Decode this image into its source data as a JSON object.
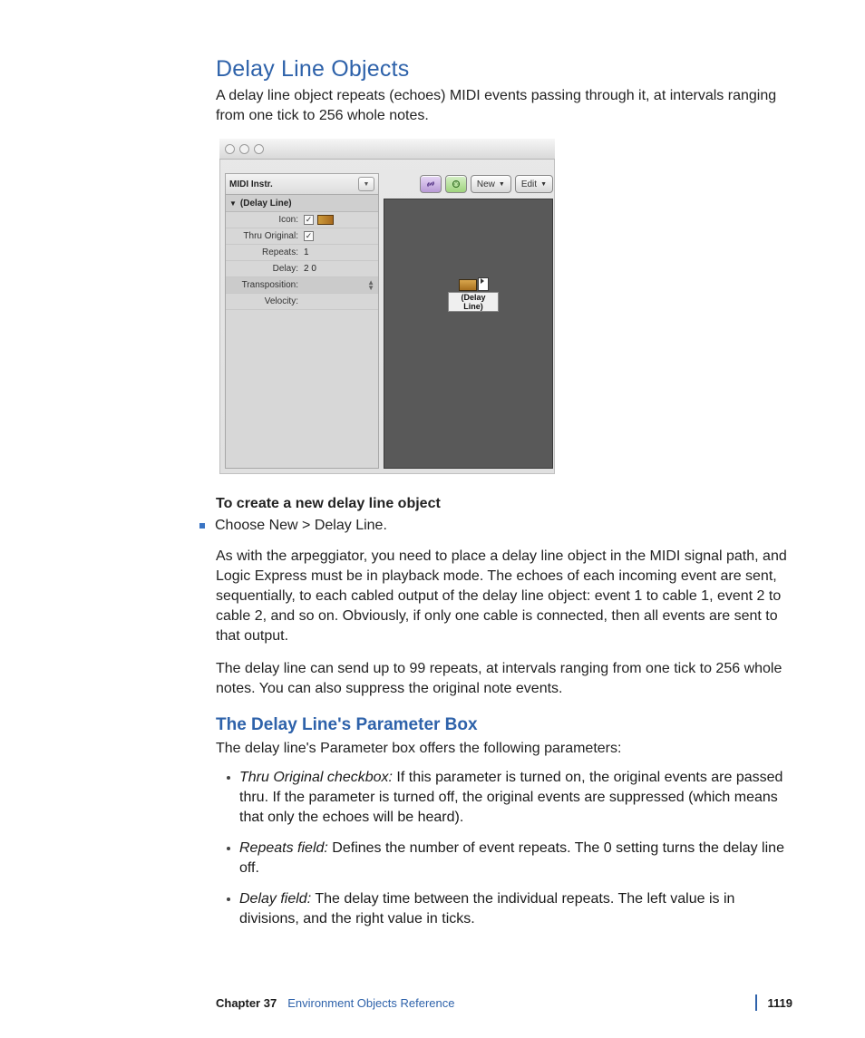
{
  "headings": {
    "h1": "Delay Line Objects",
    "h2": "The Delay Line's Parameter Box"
  },
  "paragraphs": {
    "intro": "A delay line object repeats (echoes) MIDI events passing through it, at intervals ranging from one tick to 256 whole notes.",
    "create_heading": "To create a new delay line object",
    "create_step": "Choose New > Delay Line.",
    "p2": "As with the arpeggiator, you need to place a delay line object in the MIDI signal path, and Logic Express must be in playback mode. The echoes of each incoming event are sent, sequentially, to each cabled output of the delay line object:  event 1 to cable 1, event 2 to cable 2, and so on. Obviously, if only one cable is connected, then all events are sent to that output.",
    "p3": "The delay line can send up to 99 repeats, at intervals ranging from one tick to 256 whole notes. You can also suppress the original note events.",
    "p4": "The delay line's Parameter box offers the following parameters:"
  },
  "defs": {
    "thru": {
      "term": "Thru Original checkbox:",
      "text": "  If this parameter is turned on, the original events are passed thru. If the parameter is turned off, the original events are suppressed (which means that only the echoes will be heard)."
    },
    "repeats": {
      "term": "Repeats field:",
      "text": "  Defines the number of event repeats. The 0 setting turns the delay line off."
    },
    "delay": {
      "term": "Delay field:",
      "text": "  The delay time between the individual repeats. The left value is in divisions, and the right value in ticks."
    }
  },
  "figure": {
    "window_buttons": [
      "close",
      "minimize",
      "zoom"
    ],
    "toolbar": {
      "new": "New",
      "edit": "Edit"
    },
    "inspector": {
      "title": "MIDI Instr.",
      "section": "(Delay Line)",
      "rows": {
        "icon_label": "Icon:",
        "thru_label": "Thru Original:",
        "repeats_label": "Repeats:",
        "repeats_value": "1",
        "delay_label": "Delay:",
        "delay_value": "2   0",
        "transposition_label": "Transposition:",
        "velocity_label": "Velocity:"
      }
    },
    "canvas_object_label": "(Delay Line)"
  },
  "footer": {
    "chapter": "Chapter 37",
    "title": "Environment Objects Reference",
    "page": "1119"
  }
}
